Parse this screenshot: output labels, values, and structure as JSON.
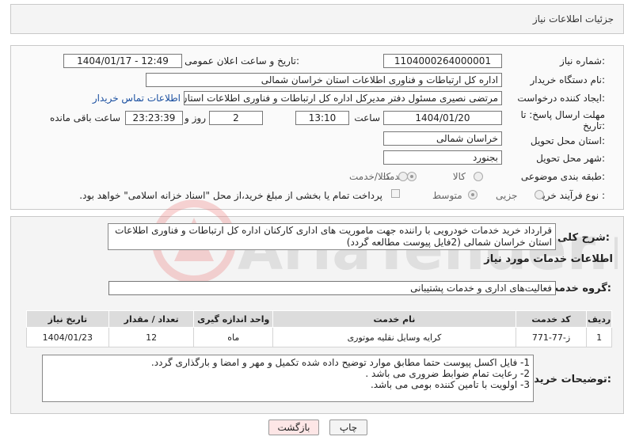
{
  "header": {
    "title": "جزئیات اطلاعات نیاز"
  },
  "watermark": {
    "text": "AriaTender.neT"
  },
  "form": {
    "need_number_label": "شماره نیاز:",
    "need_number": "1104000264000001",
    "announce_label": "تاریخ و ساعت اعلان عمومی:",
    "announce_value": "1404/01/17 - 12:49",
    "buyer_org_label": "نام دستگاه خریدار:",
    "buyer_org": "اداره کل ارتباطات و فناوری اطلاعات استان خراسان شمالی",
    "creator_label": "ایجاد کننده درخواست:",
    "creator": "مرتضی نصیری مسئول دفتر مدیرکل  اداره کل ارتباطات و فناوری اطلاعات استان خراسان شمالی",
    "contact_link": "اطلاعات تماس خریدار",
    "deadline_label_1": "مهلت ارسال پاسخ: تا",
    "deadline_label_2": "تاریخ:",
    "deadline_date": "1404/01/20",
    "time_label": "ساعت",
    "deadline_time": "13:10",
    "days_value": "2",
    "days_label": "روز و",
    "remaining_time": "23:23:39",
    "remaining_label": "ساعت باقی مانده",
    "province_label": "استان محل تحویل:",
    "province": "خراسان شمالی",
    "city_label": "شهر محل تحویل:",
    "city": "بجنورد",
    "category_label": "طبقه بندی موضوعی:",
    "category_options": [
      "کالا",
      "خدمت",
      "کالا/خدمت"
    ],
    "process_label": "نوع فرآیند خرید :",
    "process_options": [
      "جزیی",
      "متوسط"
    ],
    "payment_note": "پرداخت تمام یا بخشی از مبلغ خرید،از محل \"اسناد خزانه اسلامی\" خواهد بود."
  },
  "summary": {
    "label": "شرح کلی نیاز:",
    "text": "قرارداد خرید خدمات خودرویی با راننده جهت ماموریت های اداری کارکنان اداره کل ارتباطات و فناوری اطلاعات استان خراسان شمالی (2فایل پیوست  مطالعه گردد)"
  },
  "services": {
    "section_title": "اطلاعات خدمات مورد نیاز",
    "group_label": "گروه خدمت:",
    "group_value": "فعالیت‌های اداری و خدمات پشتیبانی",
    "table": {
      "headers": [
        "ردیف",
        "کد خدمت",
        "نام خدمت",
        "واحد اندازه گیری",
        "تعداد / مقدار",
        "تاریخ نیاز"
      ],
      "rows": [
        [
          "1",
          "ز-77-771",
          "کرایه وسایل نقلیه موتوری",
          "ماه",
          "12",
          "1404/01/23"
        ]
      ]
    }
  },
  "notes": {
    "label": "توضیحات خریدار:",
    "lines": [
      "1- فایل اکسل پیوست حتما مطابق موارد توضیح داده شده تکمیل و مهر و امضا و بارگذاری گردد.",
      "2- رعایت تمام ضوابط ضروری می باشد .",
      "3- اولویت با تامین کننده بومی می باشد."
    ]
  },
  "buttons": {
    "print": "چاپ",
    "back": "بازگشت"
  },
  "colors": {
    "header_bg": "#3d5e7e",
    "back_btn": "#fde6e6",
    "link": "#1a4fa0"
  }
}
